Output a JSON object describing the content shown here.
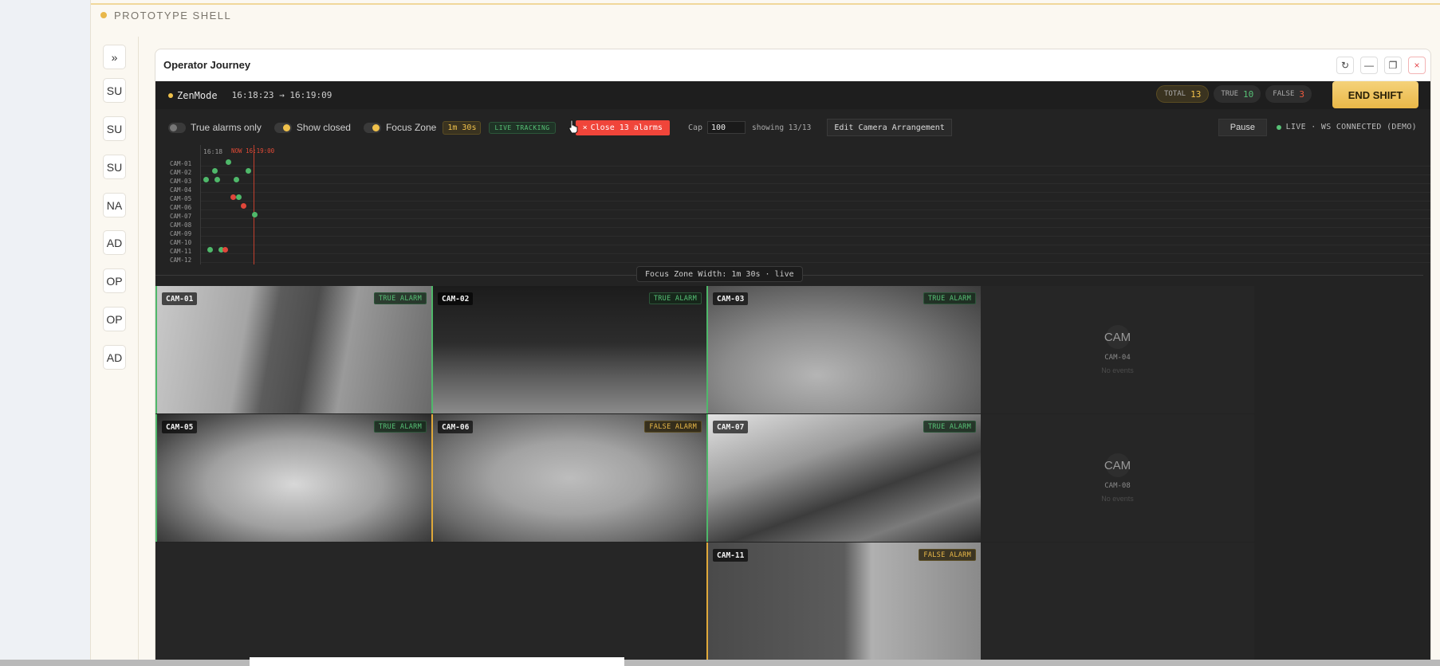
{
  "shell": {
    "title": "PROTOTYPE SHELL"
  },
  "rail": {
    "toggle_label": "»",
    "items": [
      "SU",
      "SU",
      "SU",
      "NA",
      "AD",
      "OP",
      "OP",
      "AD"
    ]
  },
  "window": {
    "title": "Operator Journey",
    "controls": {
      "refresh": "↻",
      "minimize": "—",
      "restore": "❐",
      "close": "×"
    }
  },
  "app": {
    "brand": "ZenMode",
    "time_range": "16:18:23 → 16:19:09",
    "stats": {
      "total_label": "TOTAL",
      "total_value": "13",
      "true_label": "TRUE",
      "true_value": "10",
      "false_label": "FALSE",
      "false_value": "3"
    },
    "end_shift": "END SHIFT"
  },
  "toolbar": {
    "true_alarms_only": "True alarms only",
    "show_closed": "Show closed",
    "focus_zone": "Focus Zone",
    "focus_zone_duration": "1m 30s",
    "live_tracking": "LIVE TRACKING",
    "close_alarms": "Close 13 alarms",
    "close_icon": "×",
    "cap_label": "Cap",
    "cap_value": "100",
    "showing": "showing 13/13",
    "edit_arrangement": "Edit Camera Arrangement",
    "pause": "Pause",
    "live_status": "LIVE · WS CONNECTED (DEMO)"
  },
  "timeline": {
    "start_tick": "16:18",
    "now_label": "NOW 16:19:00",
    "rows": [
      "CAM-01",
      "CAM-02",
      "CAM-03",
      "CAM-04",
      "CAM-05",
      "CAM-06",
      "CAM-07",
      "CAM-08",
      "CAM-09",
      "CAM-10",
      "CAM-11",
      "CAM-12"
    ],
    "colors": {
      "true": "#4fb86a",
      "false": "#e0463a"
    }
  },
  "focus_zone_width": "Focus Zone Width: 1m 30s · live",
  "cameras": {
    "cam01": {
      "label": "CAM-01",
      "status": "TRUE ALARM"
    },
    "cam02": {
      "label": "CAM-02",
      "status": "TRUE ALARM"
    },
    "cam03": {
      "label": "CAM-03",
      "status": "TRUE ALARM"
    },
    "cam04": {
      "icon": "CAM",
      "label": "CAM-04",
      "sub": "No events"
    },
    "cam05": {
      "label": "CAM-05",
      "status": "TRUE ALARM"
    },
    "cam06": {
      "label": "CAM-06",
      "status": "FALSE ALARM"
    },
    "cam07": {
      "label": "CAM-07",
      "status": "TRUE ALARM"
    },
    "cam08": {
      "icon": "CAM",
      "label": "CAM-08",
      "sub": "No events"
    },
    "cam11": {
      "label": "CAM-11",
      "status": "FALSE ALARM"
    }
  }
}
